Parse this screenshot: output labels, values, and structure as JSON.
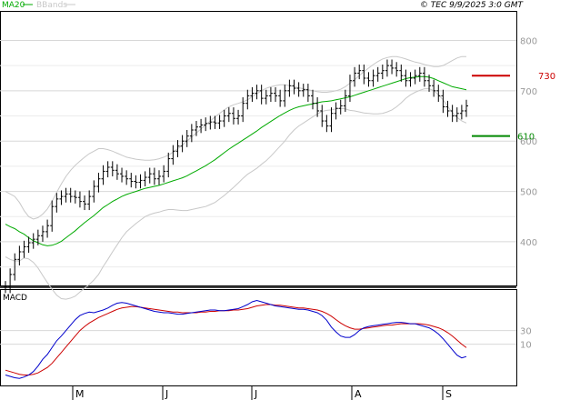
{
  "header": {
    "legend": [
      {
        "label": "MA20",
        "color": "#00aa00"
      },
      {
        "label": "BBands",
        "color": "#c8c8c8"
      }
    ],
    "timestamp": "© TEC 9/9/2025 3:0 GMT"
  },
  "colors": {
    "price": "#000000",
    "ma20": "#00aa00",
    "bbands": "#c8c8c8",
    "resistance": "#cc0000",
    "support": "#008800",
    "macd": "#0000cc",
    "signal": "#cc0000",
    "grid": "#d8d8d8"
  },
  "chart_data": [
    {
      "type": "line",
      "title": "",
      "y_ticks": [
        "800",
        "700",
        "600",
        "500",
        "400"
      ],
      "ylim": [
        315,
        855
      ],
      "months": [
        "M",
        "J",
        "J",
        "A",
        "S"
      ],
      "levels": [
        {
          "label": "730",
          "value": 730,
          "kind": "resistance"
        },
        {
          "label": "610",
          "value": 610,
          "kind": "support"
        }
      ],
      "series": [
        {
          "name": "Price",
          "values": [
            310,
            335,
            365,
            380,
            390,
            398,
            405,
            412,
            420,
            432,
            470,
            485,
            490,
            495,
            490,
            488,
            480,
            475,
            490,
            510,
            525,
            540,
            548,
            542,
            535,
            530,
            525,
            520,
            518,
            522,
            528,
            535,
            525,
            530,
            540,
            565,
            580,
            590,
            600,
            610,
            622,
            628,
            632,
            635,
            638,
            636,
            640,
            650,
            655,
            645,
            650,
            675,
            690,
            695,
            700,
            685,
            690,
            695,
            690,
            680,
            700,
            710,
            705,
            700,
            702,
            690,
            675,
            660,
            640,
            630,
            655,
            665,
            670,
            690,
            720,
            735,
            740,
            725,
            720,
            730,
            735,
            740,
            750,
            745,
            740,
            730,
            720,
            725,
            730,
            735,
            720,
            710,
            700,
            690,
            668,
            660,
            650,
            655,
            660,
            670
          ]
        },
        {
          "name": "MA20",
          "values": [
            435,
            430,
            426,
            420,
            415,
            408,
            402,
            398,
            394,
            392,
            393,
            396,
            401,
            408,
            415,
            422,
            430,
            438,
            445,
            452,
            460,
            468,
            474,
            480,
            485,
            490,
            494,
            497,
            500,
            503,
            506,
            508,
            510,
            512,
            515,
            518,
            521,
            524,
            527,
            531,
            536,
            541,
            546,
            551,
            557,
            563,
            570,
            577,
            584,
            590,
            596,
            602,
            608,
            614,
            620,
            627,
            633,
            639,
            645,
            651,
            656,
            661,
            665,
            668,
            670,
            672,
            674,
            676,
            678,
            679,
            680,
            682,
            684,
            686,
            688,
            691,
            694,
            697,
            700,
            703,
            706,
            709,
            712,
            715,
            718,
            721,
            724,
            726,
            727,
            728,
            728,
            727,
            724,
            720,
            716,
            712,
            708,
            706,
            704,
            702
          ]
        },
        {
          "name": "BBand Upper",
          "values": [
            500,
            495,
            490,
            478,
            462,
            450,
            445,
            448,
            455,
            465,
            480,
            498,
            515,
            530,
            542,
            552,
            560,
            568,
            575,
            580,
            585,
            585,
            583,
            580,
            576,
            572,
            568,
            566,
            564,
            563,
            562,
            562,
            563,
            565,
            568,
            572,
            578,
            585,
            592,
            600,
            608,
            616,
            624,
            632,
            640,
            648,
            655,
            662,
            668,
            672,
            675,
            678,
            682,
            688,
            694,
            700,
            705,
            708,
            710,
            712,
            712,
            710,
            708,
            706,
            704,
            702,
            700,
            698,
            697,
            697,
            698,
            700,
            703,
            708,
            715,
            722,
            730,
            738,
            745,
            752,
            758,
            763,
            766,
            768,
            768,
            766,
            763,
            760,
            757,
            755,
            752,
            750,
            748,
            748,
            750,
            755,
            760,
            765,
            768,
            768
          ]
        },
        {
          "name": "BBand Lower",
          "values": [
            370,
            365,
            362,
            362,
            368,
            366,
            359,
            348,
            333,
            319,
            306,
            294,
            287,
            286,
            288,
            292,
            300,
            308,
            315,
            324,
            335,
            351,
            365,
            380,
            394,
            408,
            420,
            428,
            436,
            443,
            450,
            454,
            457,
            459,
            462,
            464,
            464,
            463,
            462,
            462,
            464,
            466,
            468,
            470,
            474,
            478,
            485,
            492,
            500,
            508,
            517,
            526,
            534,
            540,
            546,
            554,
            561,
            570,
            580,
            590,
            600,
            612,
            622,
            630,
            636,
            642,
            648,
            654,
            659,
            661,
            662,
            664,
            665,
            664,
            661,
            660,
            658,
            656,
            655,
            654,
            654,
            655,
            658,
            662,
            668,
            676,
            685,
            692,
            697,
            701,
            704,
            704,
            700,
            692,
            682,
            669,
            656,
            647,
            640,
            636
          ]
        },
        {
          "name": "MACD",
          "values": [
            -35,
            -37,
            -39,
            -40,
            -38,
            -35,
            -30,
            -22,
            -12,
            -5,
            5,
            15,
            22,
            30,
            38,
            46,
            52,
            55,
            57,
            56,
            58,
            60,
            63,
            67,
            70,
            71,
            70,
            68,
            66,
            64,
            62,
            60,
            58,
            57,
            56,
            56,
            55,
            54,
            54,
            55,
            56,
            57,
            58,
            59,
            60,
            60,
            59,
            59,
            60,
            61,
            62,
            65,
            68,
            72,
            74,
            72,
            70,
            68,
            66,
            65,
            64,
            63,
            62,
            61,
            61,
            60,
            58,
            56,
            52,
            45,
            35,
            28,
            22,
            20,
            20,
            24,
            30,
            34,
            36,
            37,
            38,
            39,
            40,
            41,
            42,
            42,
            41,
            40,
            40,
            38,
            36,
            34,
            30,
            25,
            18,
            10,
            2,
            -6,
            -10,
            -8
          ]
        },
        {
          "name": "Signal",
          "values": [
            -28,
            -30,
            -32,
            -34,
            -35,
            -35,
            -34,
            -32,
            -28,
            -24,
            -18,
            -10,
            -2,
            6,
            14,
            22,
            30,
            36,
            41,
            45,
            49,
            52,
            55,
            58,
            61,
            63,
            64,
            65,
            65,
            64,
            63,
            62,
            61,
            60,
            59,
            58,
            57,
            57,
            56,
            56,
            56,
            56,
            57,
            57,
            58,
            58,
            59,
            59,
            59,
            60,
            60,
            61,
            62,
            64,
            66,
            67,
            68,
            68,
            67,
            67,
            66,
            65,
            64,
            63,
            63,
            62,
            61,
            60,
            58,
            55,
            51,
            46,
            41,
            37,
            34,
            32,
            32,
            33,
            34,
            35,
            36,
            37,
            38,
            38,
            39,
            40,
            40,
            40,
            40,
            40,
            39,
            38,
            36,
            34,
            31,
            27,
            22,
            16,
            10,
            5
          ]
        }
      ]
    },
    {
      "type": "line",
      "title": "MACD",
      "y_ticks": [
        "30",
        "10"
      ]
    }
  ]
}
